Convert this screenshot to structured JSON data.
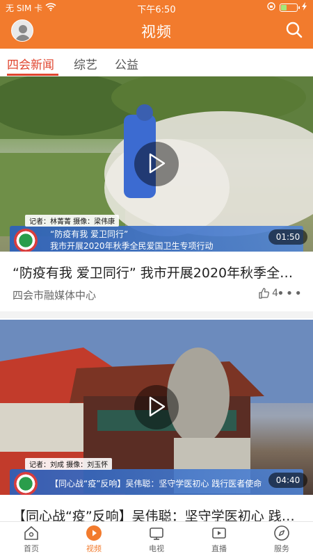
{
  "status": {
    "carrier": "无 SIM 卡",
    "time": "下午6:50",
    "battery_level": 0.35
  },
  "header": {
    "title": "视频",
    "icons": {
      "left": "avatar-icon",
      "right": "search-icon"
    }
  },
  "tabs": [
    {
      "label": "四会新闻",
      "active": true
    },
    {
      "label": "综艺",
      "active": false
    },
    {
      "label": "公益",
      "active": false
    }
  ],
  "videos": [
    {
      "title": "“防疫有我 爱卫同行” 我市开展2020年秋季全民爱国卫生专项行动",
      "source": "四会市融媒体中心",
      "likes": "4",
      "duration": "01:50",
      "caption": {
        "crew": "记者：林菁菁    摄像：梁伟康",
        "line1": "“防疫有我  爱卫同行”",
        "line2": "我市开展2020年秋季全民爱国卫生专项行动"
      }
    },
    {
      "title": "【同心战“疫”反响】吴伟聪：坚守学医初心 践行医者使命",
      "duration": "04:40",
      "caption": {
        "crew": "记者：刘成    摄像：刘玉怀",
        "line1": "【同心战“疫”反响】吴伟聪：坚守学医初心  践行医者使命"
      }
    }
  ],
  "bottom_nav": [
    {
      "label": "首页",
      "icon": "home-icon",
      "active": false
    },
    {
      "label": "视频",
      "icon": "video-play-icon",
      "active": true
    },
    {
      "label": "电视",
      "icon": "tv-icon",
      "active": false
    },
    {
      "label": "直播",
      "icon": "live-icon",
      "active": false
    },
    {
      "label": "服务",
      "icon": "compass-icon",
      "active": false
    }
  ],
  "colors": {
    "brand": "#F27B2D",
    "active_tab": "#E0452F"
  }
}
